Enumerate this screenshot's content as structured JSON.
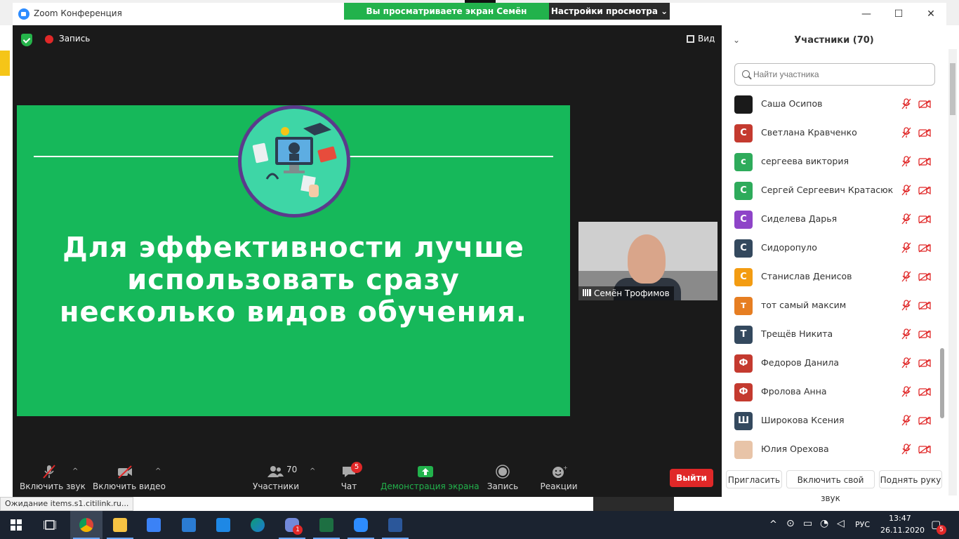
{
  "window": {
    "title": "Zoom Конференция",
    "banner_text": "Вы просматриваете экран Семён Трофимов",
    "view_settings_label": "Настройки просмотра ⌄",
    "controls": {
      "minimize": "—",
      "maximize": "☐",
      "close": "✕"
    }
  },
  "meeting": {
    "record_label": "Запись",
    "view_label": "Вид"
  },
  "slide": {
    "text_line1": "Для эффективности лучше",
    "text_line2": "использовать сразу",
    "text_line3": "несколько видов обучения."
  },
  "video": {
    "speaker_name": "Семён Трофимов"
  },
  "toolbar": {
    "unmute_label": "Включить звук",
    "start_video_label": "Включить видео",
    "participants_label": "Участники",
    "participants_count": "70",
    "chat_label": "Чат",
    "chat_badge": "5",
    "share_label": "Демонстрация экрана",
    "record_label": "Запись",
    "reactions_label": "Реакции",
    "leave_label": "Выйти",
    "colors": {
      "share": "#22b24c",
      "leave": "#e02828"
    }
  },
  "panel": {
    "title": "Участники (70)",
    "search_placeholder": "Найти участника",
    "participants": [
      {
        "name": "Саша Осипов",
        "initial": "",
        "color": "#1a1a1a"
      },
      {
        "name": "Светлана Кравченко",
        "initial": "С",
        "color": "#c43a2f"
      },
      {
        "name": "сергеева виктория",
        "initial": "с",
        "color": "#2eab5b"
      },
      {
        "name": "Сергей Сергеевич Кратасюк",
        "initial": "С",
        "color": "#2eab5b"
      },
      {
        "name": "Сиделева Дарья",
        "initial": "С",
        "color": "#8e44c8"
      },
      {
        "name": "Сидоропуло",
        "initial": "С",
        "color": "#34495e"
      },
      {
        "name": "Станислав Денисов",
        "initial": "С",
        "color": "#f39c12"
      },
      {
        "name": "тот самый максим",
        "initial": "т",
        "color": "#e67e22"
      },
      {
        "name": "Трещёв Никита",
        "initial": "Т",
        "color": "#34495e"
      },
      {
        "name": "Федоров Данила",
        "initial": "Ф",
        "color": "#c43a2f"
      },
      {
        "name": "Фролова Анна",
        "initial": "Ф",
        "color": "#c43a2f"
      },
      {
        "name": "Широкова Ксения",
        "initial": "Ш",
        "color": "#34495e"
      },
      {
        "name": "Юлия Орехова",
        "initial": "",
        "color": "#e8c4a8"
      }
    ],
    "invite_label": "Пригласить",
    "unmute_self_label": "Включить свой звук",
    "raise_hand_label": "Поднять руку"
  },
  "browser": {
    "status_text": "Ожидание items.s1.citilink.ru..."
  },
  "taskbar": {
    "language": "РУС",
    "time": "13:47",
    "date": "26.11.2020",
    "discord_badge": "1",
    "notification_count": "5"
  }
}
